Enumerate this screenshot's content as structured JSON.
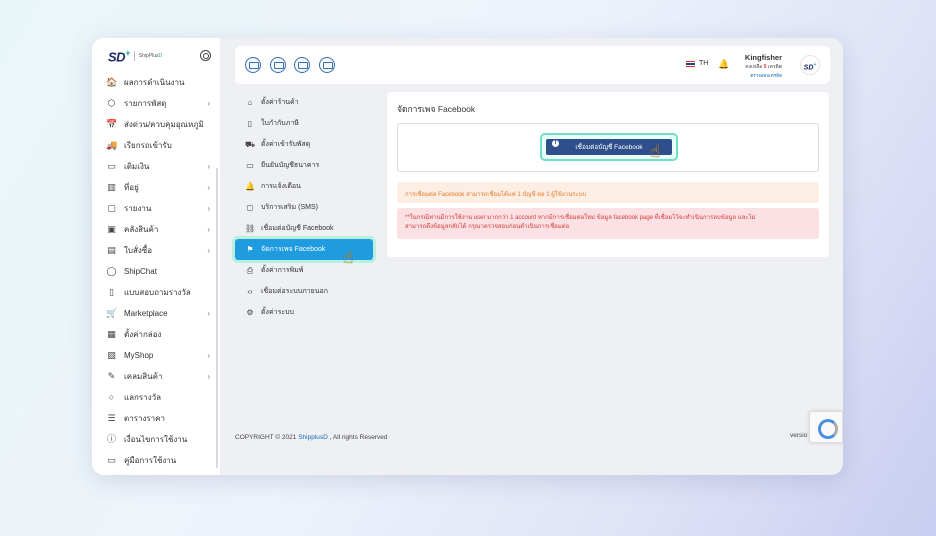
{
  "brand": {
    "logo": "SD",
    "plus": "+",
    "name_prefix": "ShipPlus",
    "name_suffix": "D"
  },
  "sidebar": {
    "items": [
      {
        "icon": "🏠",
        "label": "ผลการดำเนินงาน",
        "arrow": false
      },
      {
        "icon": "⬡",
        "label": "รายการพัสดุ",
        "arrow": true
      },
      {
        "icon": "📅",
        "label": "ส่งด่วน/ควบคุมอุณหภูมิ",
        "arrow": false
      },
      {
        "icon": "🚚",
        "label": "เรียกรถเข้ารับ",
        "arrow": false
      },
      {
        "icon": "▭",
        "label": "เติมเงิน",
        "arrow": true
      },
      {
        "icon": "▥",
        "label": "ที่อยู่",
        "arrow": true
      },
      {
        "icon": "▢",
        "label": "รายงาน",
        "arrow": true
      },
      {
        "icon": "▣",
        "label": "คลังสินค้า",
        "arrow": true
      },
      {
        "icon": "▤",
        "label": "ใบสั่งซื้อ",
        "arrow": true
      },
      {
        "icon": "◯",
        "label": "ShipChat",
        "arrow": false
      },
      {
        "icon": "▯",
        "label": "แบบสอบถามรางวัล",
        "arrow": false
      },
      {
        "icon": "🛒",
        "label": "Marketplace",
        "arrow": true
      },
      {
        "icon": "▦",
        "label": "ตั้งค่ากล่อง",
        "arrow": false
      },
      {
        "icon": "▧",
        "label": "MyShop",
        "arrow": true
      },
      {
        "icon": "✎",
        "label": "เคลมสินค้า",
        "arrow": true
      },
      {
        "icon": "○",
        "label": "แลกรางวัล",
        "arrow": false
      },
      {
        "icon": "☰",
        "label": "ตารางราคา",
        "arrow": false
      },
      {
        "icon": "ⓘ",
        "label": "เงื่อนไขการใช้งาน",
        "arrow": false
      },
      {
        "icon": "▭",
        "label": "คู่มือการใช้งาน",
        "arrow": false
      }
    ]
  },
  "header": {
    "lang": "TH",
    "user_name": "Kingfisher",
    "credit_label": "คงเหลือ",
    "credit_value": "0",
    "credit_unit": "เครดิต",
    "user_link": "ตรวจสอบเครดิต"
  },
  "submenu": {
    "items": [
      {
        "icon": "⌂",
        "label": "ตั้งค่าร้านค้า"
      },
      {
        "icon": "▯",
        "label": "ใบกำกับภาษี"
      },
      {
        "icon": "⛟",
        "label": "ตั้งค่าเข้ารับพัสดุ"
      },
      {
        "icon": "▭",
        "label": "ยืนยันบัญชีธนาคาร"
      },
      {
        "icon": "🔔",
        "label": "การแจ้งเตือน"
      },
      {
        "icon": "◻",
        "label": "บริการเสริม (SMS)"
      },
      {
        "icon": "⛓",
        "label": "เชื่อมต่อบัญชี Facebook"
      },
      {
        "icon": "⚑",
        "label": "จัดการเพจ Facebook",
        "active": true
      },
      {
        "icon": "⎙",
        "label": "ตั้งค่าการพิมพ์"
      },
      {
        "icon": "‹›",
        "label": "เชื่อมต่อระบบภายนอก"
      },
      {
        "icon": "⚙",
        "label": "ตั้งค่าระบบ"
      }
    ]
  },
  "main": {
    "title": "จัดการเพจ Facebook",
    "connect_button": "เชื่อมต่อบัญชี Facebook",
    "warning": "การเชื่อมต่อ Facebook สามารถเชื่อมได้แค่ 1 บัญชี ต่อ 1 ผู้ใช้งานระบบ",
    "danger_line1": "**ในกรณีท่านมีการใช้งาน user มากกว่า 1 account หากมีการเชื่อมต่อใหม่ ข้อมูล facebook page ที่เชื่อมไว้จะทำเนินการลบข้อมูล และไม่",
    "danger_line2": "สามารถดึงข้อมูลกลับได้ กรุณาตรวจสอบก่อนดำเนินการเชื่อมต่อ"
  },
  "footer": {
    "copyright": "COPYRIGHT © 2021 ",
    "brand": "ShipplusD",
    "rights": " , All rights Reserved",
    "version": "versio"
  }
}
